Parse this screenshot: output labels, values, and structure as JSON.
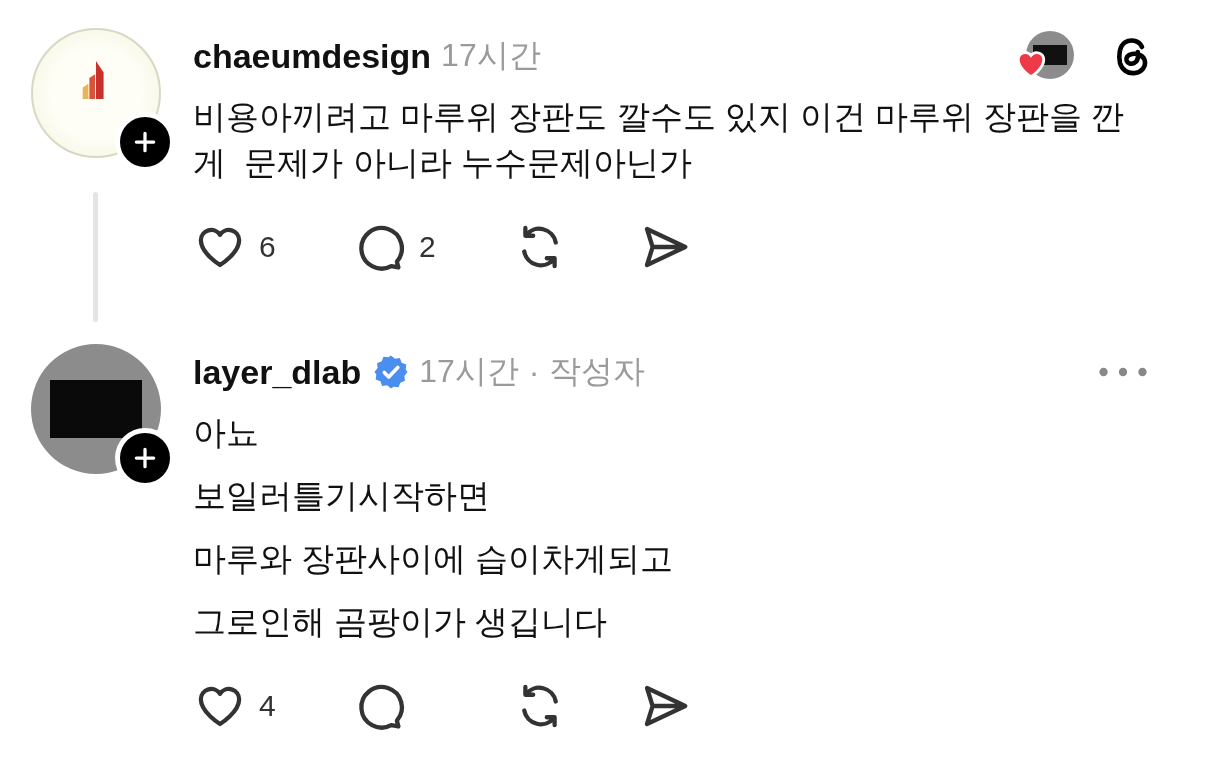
{
  "posts": [
    {
      "author": "chaeumdesign",
      "verified": false,
      "time": "17시간",
      "kind": "root",
      "following": false,
      "reply_line": true,
      "paragraphs": [
        "비용아끼려고 마루위 장판도 깔수도 있지 이건 마루위 장판을 깐게  문제가 아니라 누수문제아닌가"
      ],
      "likes": "6",
      "replies": "2"
    },
    {
      "author": "layer_dlab",
      "verified": true,
      "time": "17시간",
      "separator": "·",
      "author_tag": "작성자",
      "kind": "reply",
      "following": false,
      "reply_line": false,
      "paragraphs": [
        "아뇨",
        "보일러틀기시작하면",
        "마루와 장판사이에 습이차게되고",
        "그로인해 곰팡이가 생깁니다"
      ],
      "likes": "4"
    }
  ]
}
